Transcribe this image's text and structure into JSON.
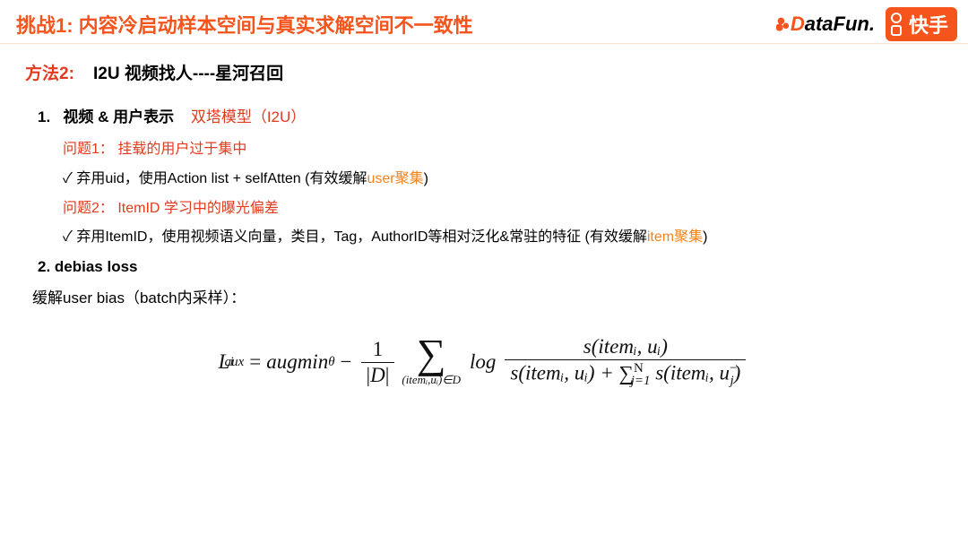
{
  "header": {
    "title": "挑战1: 内容冷启动样本空间与真实求解空间不一致性",
    "logo_datafun_d": "D",
    "logo_datafun_rest": "ataFun.",
    "logo_kuaishou": "快手"
  },
  "method": {
    "label": "方法2:",
    "name": "I2U 视频找人----星河召回"
  },
  "point1": {
    "num": "1.",
    "title": "视频 & 用户表示",
    "red": "双塔模型（I2U）",
    "q1": "问题1： 挂载的用户过于集中",
    "b1_pre": "✓ 弃用uid，使用Action list + selfAtten (有效缓解",
    "b1_hl": "user聚集",
    "b1_post": ")",
    "q2": "问题2： ItemID 学习中的曝光偏差",
    "b2_pre": "✓ 弃用ItemID，使用视频语义向量，类目，Tag，AuthorID等相对泛化&常驻的特征 (有效缓解",
    "b2_hl": "item聚集",
    "b2_post": ")"
  },
  "point2": {
    "title": "2. debias loss",
    "userbias": "缓解user bias（batch内采样）："
  },
  "formula": {
    "lhs_L": "L",
    "lhs_sup": "i",
    "lhs_sub": "aux",
    "eq": " = ",
    "augmin": "augmin",
    "theta": "θ",
    "minus": " − ",
    "frac1_num": "1",
    "frac1_den_pre": "|",
    "frac1_den_mid": "D",
    "frac1_den_post": "|",
    "sigma_label": "(itemᵢ,uᵢ)∈D",
    "log": "log",
    "num_s": "s(itemᵢ, uᵢ)",
    "den_left": "s(itemᵢ, uᵢ) + ",
    "den_sum_pre": "∑",
    "den_sum_top": "N",
    "den_sum_bot": "j=1",
    "den_right": " s(itemᵢ, u",
    "den_right_sup": "−",
    "den_right_sub": "j",
    "den_close": ")"
  }
}
